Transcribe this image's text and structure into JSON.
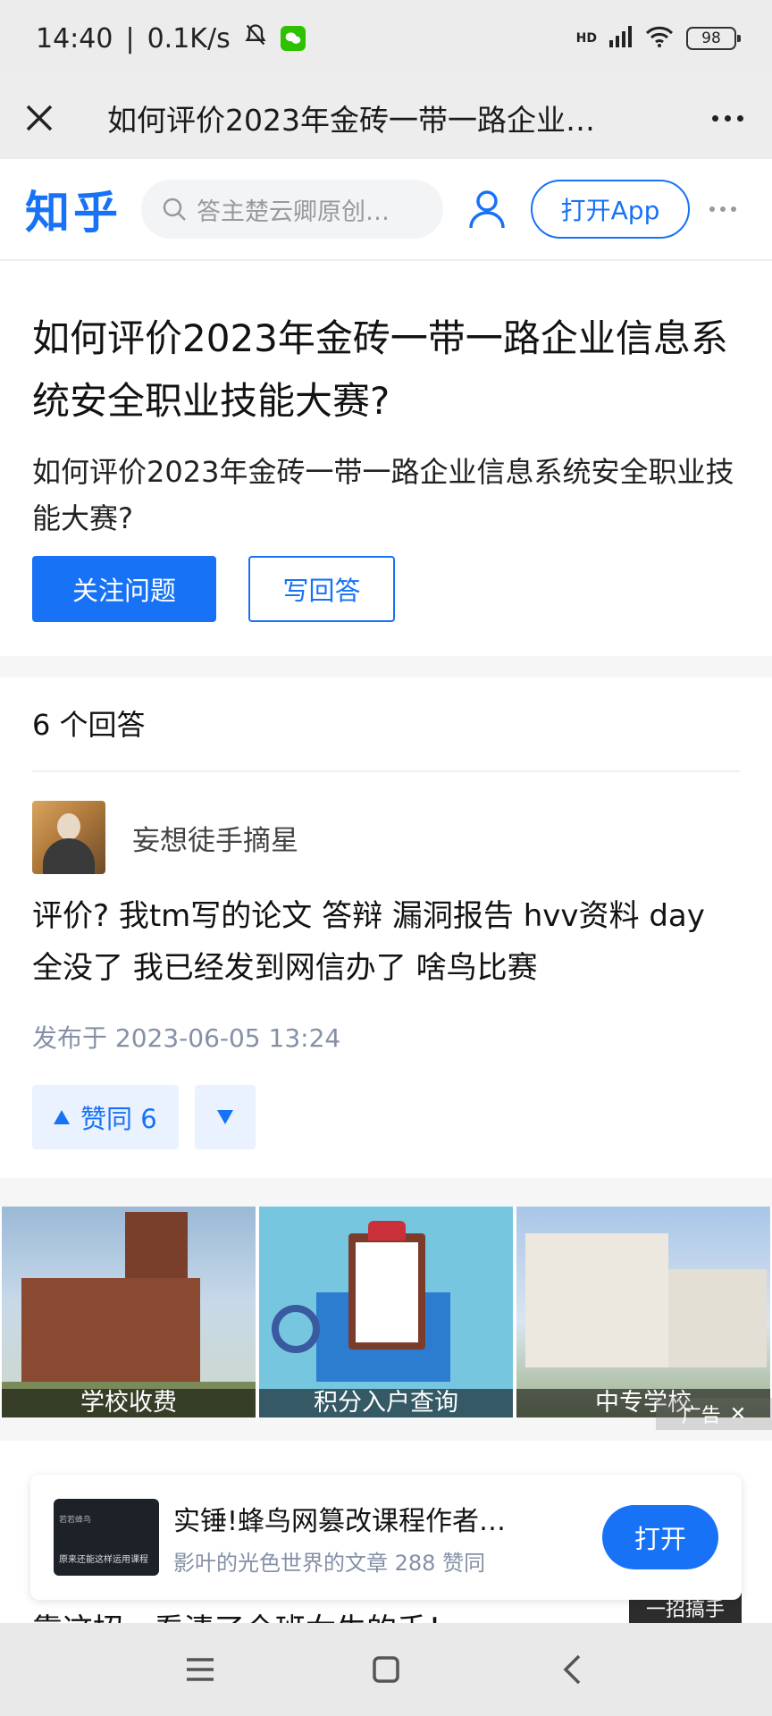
{
  "status_bar": {
    "time": "14:40",
    "speed": "0.1K/s",
    "network": "HD",
    "battery": "98"
  },
  "browser": {
    "title": "如何评价2023年金砖一带一路企业…"
  },
  "zhihu_header": {
    "logo": "知乎",
    "search_placeholder": "答主楚云卿原创…",
    "open_app_label": "打开App"
  },
  "question": {
    "title": "如何评价2023年金砖一带一路企业信息系统安全职业技能大赛?",
    "description": "如何评价2023年金砖一带一路企业信息系统安全职业技能大赛?",
    "follow_label": "关注问题",
    "write_label": "写回答"
  },
  "answers": {
    "count_label": "6 个回答",
    "items": [
      {
        "author": "妄想徒手摘星",
        "content": "评价? 我tm写的论文 答辩 漏洞报告 hvv资料 day 全没了 我已经发到网信办了 啥鸟比赛",
        "time": "发布于 2023-06-05 13:24",
        "upvote_label": "赞同 6"
      }
    ]
  },
  "ads": {
    "tiles": [
      {
        "label": "学校收费"
      },
      {
        "label": "积分入户查询"
      },
      {
        "label": "中专学校"
      }
    ],
    "tag": "广告"
  },
  "recommendation": {
    "thumb_line1": "若若蜂鸟",
    "thumb_line2": "原来还能这样运用课程",
    "title": "实锤!蜂鸟网篡改课程作者…",
    "subtitle": "影叶的光色世界的文章 288 赞同",
    "open_label": "打开"
  },
  "peek": {
    "text": "靠这招，看清了全班女生的手！",
    "image_text": "一招搞手"
  },
  "colors": {
    "brand": "#1772f6",
    "vote_bg": "#eaf2ff",
    "meta_text": "#8590a6"
  }
}
